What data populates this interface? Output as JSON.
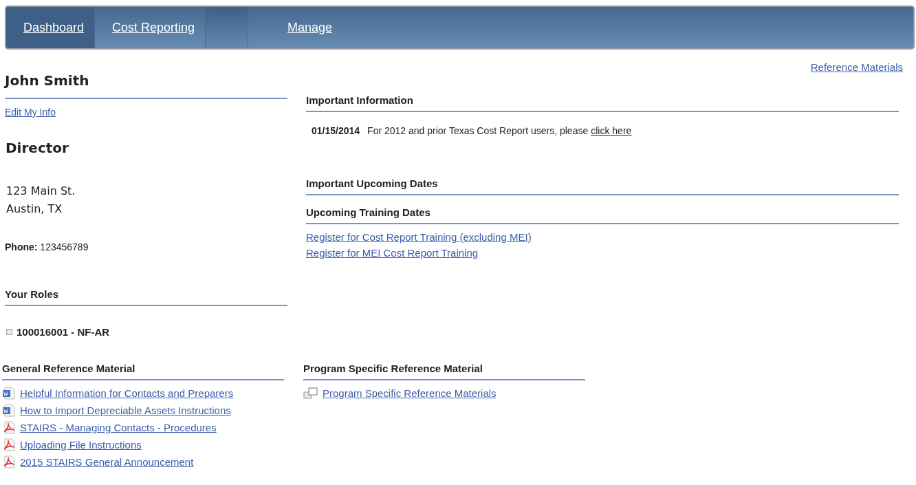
{
  "nav": {
    "tabs": [
      {
        "label": "Dashboard",
        "selected": true
      },
      {
        "label": "Cost Reporting",
        "selected": false
      }
    ],
    "right_tab": {
      "label": "Manage",
      "selected": false
    }
  },
  "top_link": "Reference Materials",
  "profile": {
    "name": "John Smith",
    "edit_link": "Edit My Info",
    "title": "Director",
    "address": [
      "123 Main St.",
      "Austin, TX"
    ],
    "phone_label": "Phone:",
    "phone": "123456789"
  },
  "roles": {
    "heading": "Your Roles",
    "items": [
      {
        "label": "100016001 - NF-AR",
        "expanded": false
      }
    ]
  },
  "important_information": {
    "heading": "Important Information",
    "items": [
      {
        "date": "01/15/2014",
        "text": "For 2012 and prior Texas Cost Report users, please",
        "link": "click here"
      }
    ]
  },
  "upcoming_dates": {
    "heading": "Important Upcoming Dates"
  },
  "training": {
    "heading": "Upcoming Training Dates",
    "links": [
      "Register for Cost Report Training (excluding MEI)",
      "Register for MEI Cost Report Training"
    ]
  },
  "general_reference": {
    "heading": "General Reference Material",
    "items": [
      {
        "kind": "word",
        "label": "Helpful Information for Contacts and Preparers"
      },
      {
        "kind": "word",
        "label": "How to Import Depreciable Assets Instructions"
      },
      {
        "kind": "pdf",
        "label": "STAIRS - Managing Contacts - Procedures"
      },
      {
        "kind": "pdf",
        "label": "Uploading File Instructions"
      },
      {
        "kind": "pdf",
        "label": "2015 STAIRS General Announcement"
      }
    ]
  },
  "program_reference": {
    "heading": "Program Specific Reference Material",
    "items": [
      {
        "kind": "window",
        "label": "Program Specific Reference Materials"
      }
    ]
  }
}
